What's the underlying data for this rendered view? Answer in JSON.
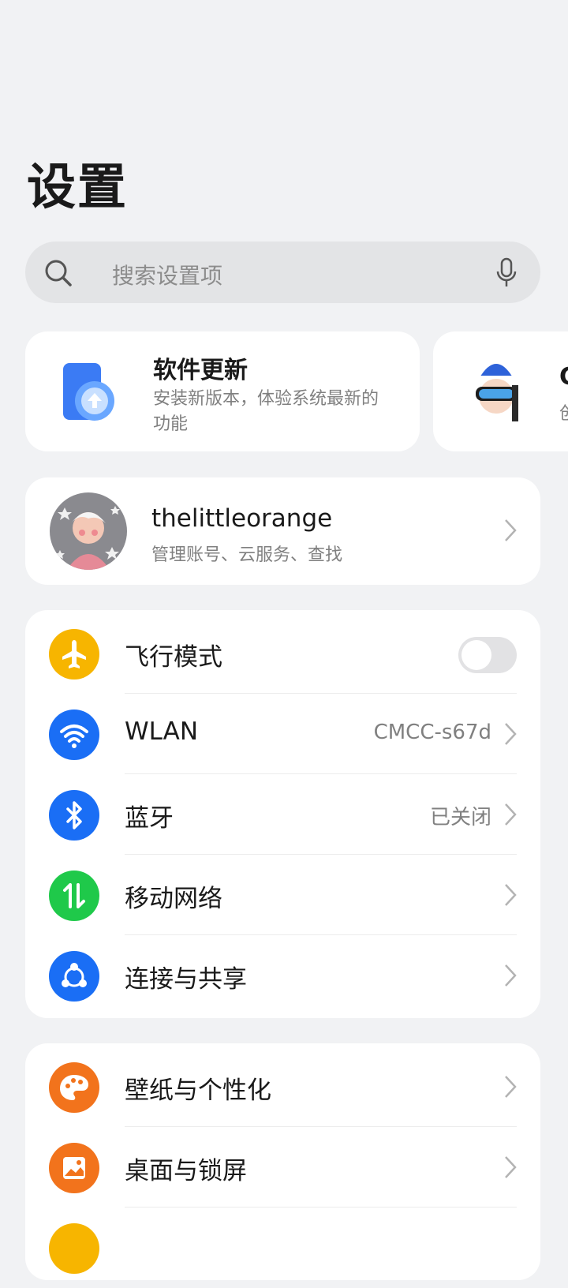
{
  "header": {
    "title": "设置"
  },
  "search": {
    "placeholder": "搜索设置项"
  },
  "cards": {
    "update": {
      "title": "软件更新",
      "desc": "安装新版本，体验系统最新的功能"
    },
    "partial": {
      "title": "C",
      "desc": "创"
    }
  },
  "account": {
    "name": "thelittleorange",
    "sub": "管理账号、云服务、查找"
  },
  "group1": [
    {
      "label": "飞行模式",
      "icon": "airplane-icon",
      "color": "#f7b500",
      "toggle": false
    },
    {
      "label": "WLAN",
      "value": "CMCC-s67d",
      "icon": "wifi-icon",
      "color": "#1a6ef5"
    },
    {
      "label": "蓝牙",
      "value": "已关闭",
      "icon": "bluetooth-icon",
      "color": "#1a6ef5"
    },
    {
      "label": "移动网络",
      "icon": "mobile-data-icon",
      "color": "#1fc94a"
    },
    {
      "label": "连接与共享",
      "icon": "share-icon",
      "color": "#1a6ef5"
    }
  ],
  "group2": [
    {
      "label": "壁纸与个性化",
      "icon": "palette-icon",
      "color": "#f2731c"
    },
    {
      "label": "桌面与锁屏",
      "icon": "picture-icon",
      "color": "#f2731c"
    },
    {
      "label": "",
      "icon": "yellow-icon",
      "color": "#f7b500"
    }
  ]
}
